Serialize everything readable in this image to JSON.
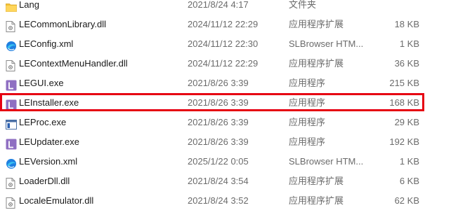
{
  "files": [
    {
      "name": "Lang",
      "date": "2021/8/24 4:17",
      "type": "文件夹",
      "size": "",
      "icon": "folder-icon"
    },
    {
      "name": "LECommonLibrary.dll",
      "date": "2024/11/12 22:29",
      "type": "应用程序扩展",
      "size": "18 KB",
      "icon": "dll-file-icon"
    },
    {
      "name": "LEConfig.xml",
      "date": "2024/11/12 22:30",
      "type": "SLBrowser HTM...",
      "size": "1 KB",
      "icon": "browser-file-icon"
    },
    {
      "name": "LEContextMenuHandler.dll",
      "date": "2024/11/12 22:29",
      "type": "应用程序扩展",
      "size": "36 KB",
      "icon": "dll-file-icon"
    },
    {
      "name": "LEGUI.exe",
      "date": "2021/8/26 3:39",
      "type": "应用程序",
      "size": "215 KB",
      "icon": "le-app-icon"
    },
    {
      "name": "LEInstaller.exe",
      "date": "2021/8/26 3:39",
      "type": "应用程序",
      "size": "168 KB",
      "icon": "le-app-icon"
    },
    {
      "name": "LEProc.exe",
      "date": "2021/8/26 3:39",
      "type": "应用程序",
      "size": "29 KB",
      "icon": "window-app-icon"
    },
    {
      "name": "LEUpdater.exe",
      "date": "2021/8/26 3:39",
      "type": "应用程序",
      "size": "192 KB",
      "icon": "le-app-icon"
    },
    {
      "name": "LEVersion.xml",
      "date": "2025/1/22 0:05",
      "type": "SLBrowser HTM...",
      "size": "1 KB",
      "icon": "browser-file-icon"
    },
    {
      "name": "LoaderDll.dll",
      "date": "2021/8/24 3:54",
      "type": "应用程序扩展",
      "size": "6 KB",
      "icon": "dll-file-icon"
    },
    {
      "name": "LocaleEmulator.dll",
      "date": "2021/8/24 3:52",
      "type": "应用程序扩展",
      "size": "62 KB",
      "icon": "dll-file-icon"
    }
  ],
  "highlight": {
    "row": 5,
    "color": "#e60012"
  },
  "colors": {
    "folder": "#f3c236",
    "le_app": "#8f6fc2",
    "browser": "#1f7fe0"
  }
}
